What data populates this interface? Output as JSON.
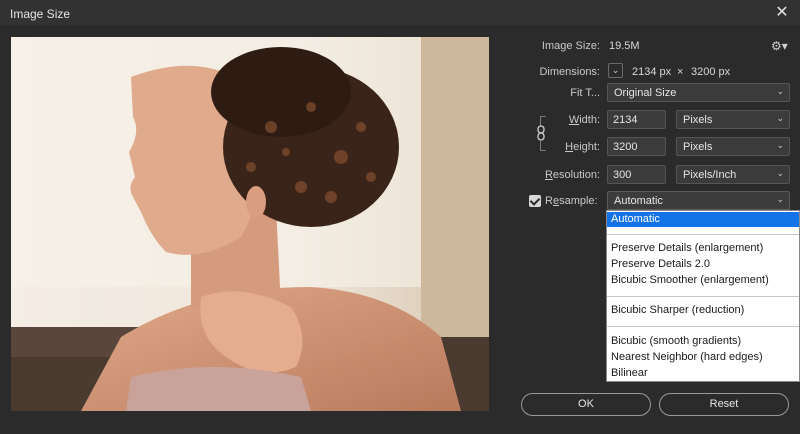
{
  "window": {
    "title": "Image Size"
  },
  "info": {
    "image_size_label": "Image Size:",
    "image_size_value": "19.5M",
    "dimensions_label": "Dimensions:",
    "dimensions_width": "2134 px",
    "dimensions_sep": "×",
    "dimensions_height": "3200 px",
    "fit_to_label": "Fit T...",
    "fit_to_value": "Original Size"
  },
  "width": {
    "label": "Width:",
    "value": "2134",
    "unit": "Pixels"
  },
  "height": {
    "label": "Height:",
    "value": "3200",
    "unit": "Pixels"
  },
  "resolution": {
    "label": "Resolution:",
    "value": "300",
    "unit": "Pixels/Inch"
  },
  "resample": {
    "label": "Resample:",
    "checked": true,
    "value": "Automatic",
    "options": [
      "Automatic",
      "Preserve Details (enlargement)",
      "Preserve Details 2.0",
      "Bicubic Smoother (enlargement)",
      "Bicubic Sharper (reduction)",
      "Bicubic (smooth gradients)",
      "Nearest Neighbor (hard edges)",
      "Bilinear"
    ]
  },
  "buttons": {
    "ok": "OK",
    "reset": "Reset"
  },
  "icons": {
    "close": "close-icon",
    "gear": "gear-icon",
    "chain": "link-chain-icon",
    "chevron": "chevron-down-icon"
  }
}
